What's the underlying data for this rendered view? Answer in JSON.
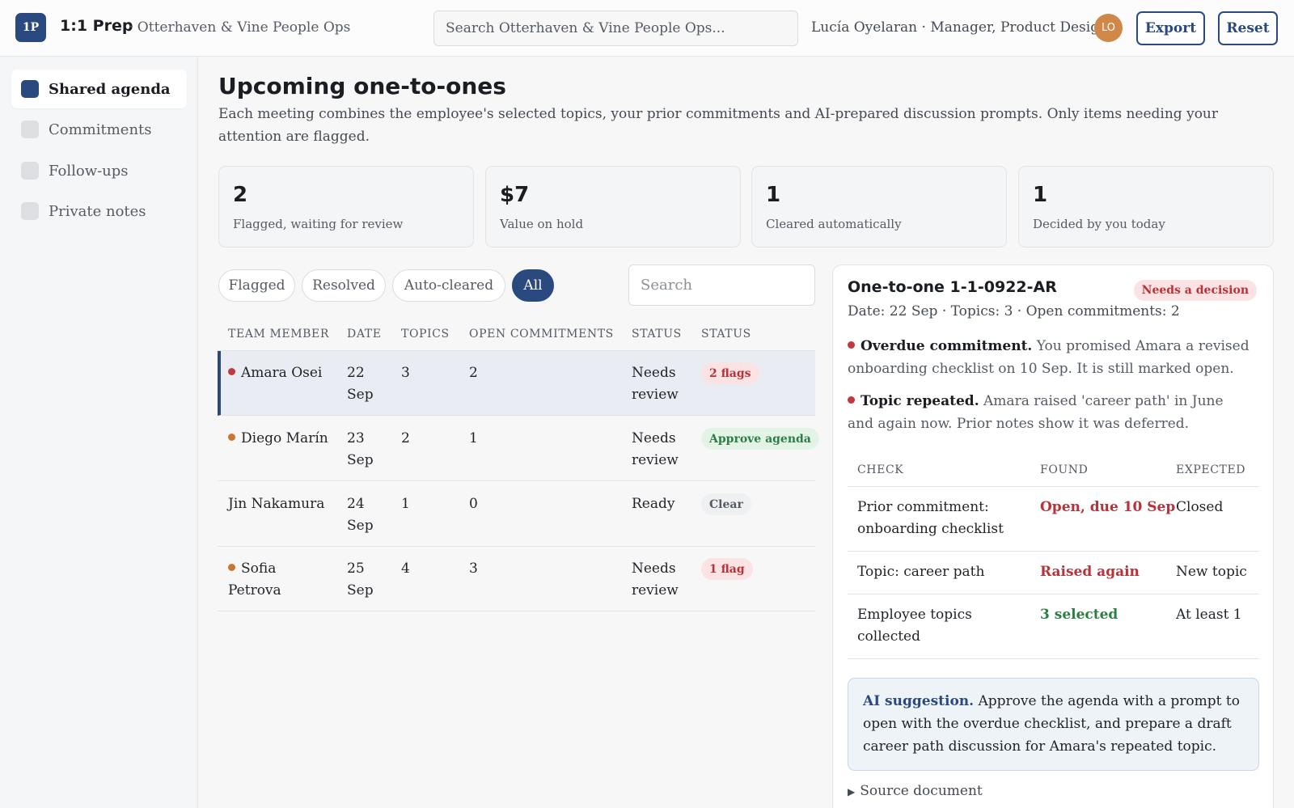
{
  "header": {
    "logo": "1P",
    "app_name": "1:1 Prep",
    "org": "· Otterhaven & Vine People Ops",
    "search_placeholder": "Search Otterhaven & Vine People Ops...",
    "user": "Lucía Oyelaran · Manager, Product Design",
    "avatar_initials": "LO",
    "export_label": "Export",
    "reset_label": "Reset"
  },
  "sidebar": {
    "items": [
      {
        "label": "Shared agenda",
        "active": true
      },
      {
        "label": "Commitments",
        "active": false
      },
      {
        "label": "Follow-ups",
        "active": false
      },
      {
        "label": "Private notes",
        "active": false
      }
    ]
  },
  "main": {
    "title": "Upcoming one-to-ones",
    "subtitle": "Each meeting combines the employee's selected topics, your prior commitments and AI-prepared discussion prompts. Only items needing your attention are flagged."
  },
  "stats": [
    {
      "value": "2",
      "caption": "Flagged, waiting for review"
    },
    {
      "value": "$7",
      "caption": "Value on hold"
    },
    {
      "value": "1",
      "caption": "Cleared automatically"
    },
    {
      "value": "1",
      "caption": "Decided by you today"
    }
  ],
  "filters": {
    "chips": [
      "Flagged",
      "Resolved",
      "Auto-cleared",
      "All"
    ],
    "active": "All",
    "search_placeholder": "Search"
  },
  "table": {
    "columns": [
      "TEAM MEMBER",
      "DATE",
      "TOPICS",
      "OPEN COMMITMENTS",
      "STATUS",
      "STATUS"
    ],
    "rows": [
      {
        "name": "Amara Osei",
        "date": "22 Sep",
        "topics": "3",
        "open": "2",
        "status": "Needs review",
        "badge": "2 flags",
        "badge_tone": "red",
        "dot_color": "#c0393f",
        "selected": true
      },
      {
        "name": "Diego Marín",
        "date": "23 Sep",
        "topics": "2",
        "open": "1",
        "status": "Needs review",
        "badge": "Approve agenda",
        "badge_tone": "green",
        "dot_color": "#c9772e",
        "selected": false
      },
      {
        "name": "Jin Nakamura",
        "date": "24 Sep",
        "topics": "1",
        "open": "0",
        "status": "Ready",
        "badge": "Clear",
        "badge_tone": "grey",
        "dot_color": "",
        "selected": false
      },
      {
        "name": "Sofia Petrova",
        "date": "25 Sep",
        "topics": "4",
        "open": "3",
        "status": "Needs review",
        "badge": "1 flag",
        "badge_tone": "red",
        "dot_color": "#c9772e",
        "selected": false
      }
    ]
  },
  "detail": {
    "title": "One-to-one 1-1-0922-AR",
    "badge": "Needs a decision",
    "meta": "Date: 22 Sep · Topics: 3 · Open commitments: 2",
    "flags": [
      {
        "title": "Overdue commitment.",
        "text": "You promised Amara a revised onboarding checklist on 10 Sep. It is still marked open."
      },
      {
        "title": "Topic repeated.",
        "text": "Amara raised 'career path' in June and again now. Prior notes show it was deferred."
      }
    ],
    "checks": {
      "columns": [
        "CHECK",
        "FOUND",
        "EXPECTED"
      ],
      "rows": [
        {
          "check": "Prior commitment: onboarding checklist",
          "found": "Open, due 10 Sep",
          "found_tone": "red",
          "expected": "Closed"
        },
        {
          "check": "Topic: career path",
          "found": "Raised again",
          "found_tone": "red",
          "expected": "New topic"
        },
        {
          "check": "Employee topics collected",
          "found": "3 selected",
          "found_tone": "green",
          "expected": "At least 1"
        }
      ]
    },
    "ai_label": "AI suggestion.",
    "ai_text": "Approve the agenda with a prompt to open with the overdue checklist, and prepare a draft career path discussion for Amara's repeated topic.",
    "source_label": "Source document"
  }
}
